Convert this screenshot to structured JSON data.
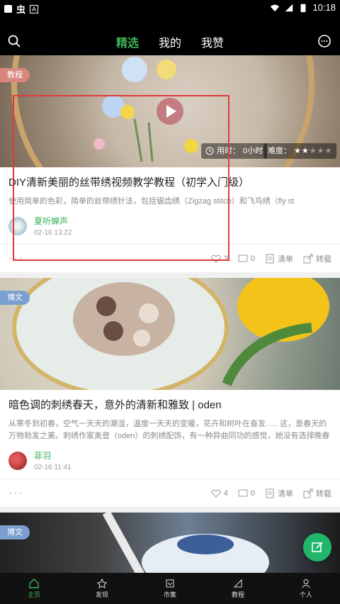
{
  "status": {
    "time": "10:18"
  },
  "tabs": {
    "items": [
      "精选",
      "我的",
      "我赞"
    ],
    "active": 0
  },
  "cards": [
    {
      "badge": "教程",
      "time_label": "用时：",
      "time_value": "0小时",
      "difficulty_label": "难度：",
      "difficulty_rating": 2,
      "difficulty_max": 5,
      "title": "DIY清新美丽的丝带绣视频教学教程（初学入门级）",
      "desc": "使用简单的色彩，简单的丝带绣针法，包括锯齿绣（Zigzag stitch）和飞鸟绣（fly st",
      "author": "夏听蝉声",
      "date": "02-16 13:22",
      "likes": "3",
      "comments": "0",
      "collect_label": "清单",
      "share_label": "转载"
    },
    {
      "badge": "博文",
      "title": "暗色调的刺绣春天，意外的清新和雅致 | oden",
      "desc": "从寒冬到初春，空气一天天的潮湿，温度一天天的变暖，花卉和树叶在奋发….. 这，是春天的万物勃发之美。刺绣作家奥登（oden）的刺绣配饰，有一种异曲同功的感觉，她没有选择晚春和初夏，而是选择初春的植物和花卉，以偏暗倔绿的色调，结合刺绣和丝带绣，呈现初春的美好。法国刺绣的精致，丝带绣的立体…",
      "author": "菲羽",
      "date": "02-16 11:41",
      "likes": "4",
      "comments": "0",
      "collect_label": "清单",
      "share_label": "转载"
    },
    {
      "badge": "博文"
    }
  ],
  "nav": [
    "主页",
    "发现",
    "市集",
    "教程",
    "个人"
  ],
  "colors": {
    "accent": "#3db35a",
    "fab": "#22b66b",
    "highlight_box": "#e23a3a"
  }
}
